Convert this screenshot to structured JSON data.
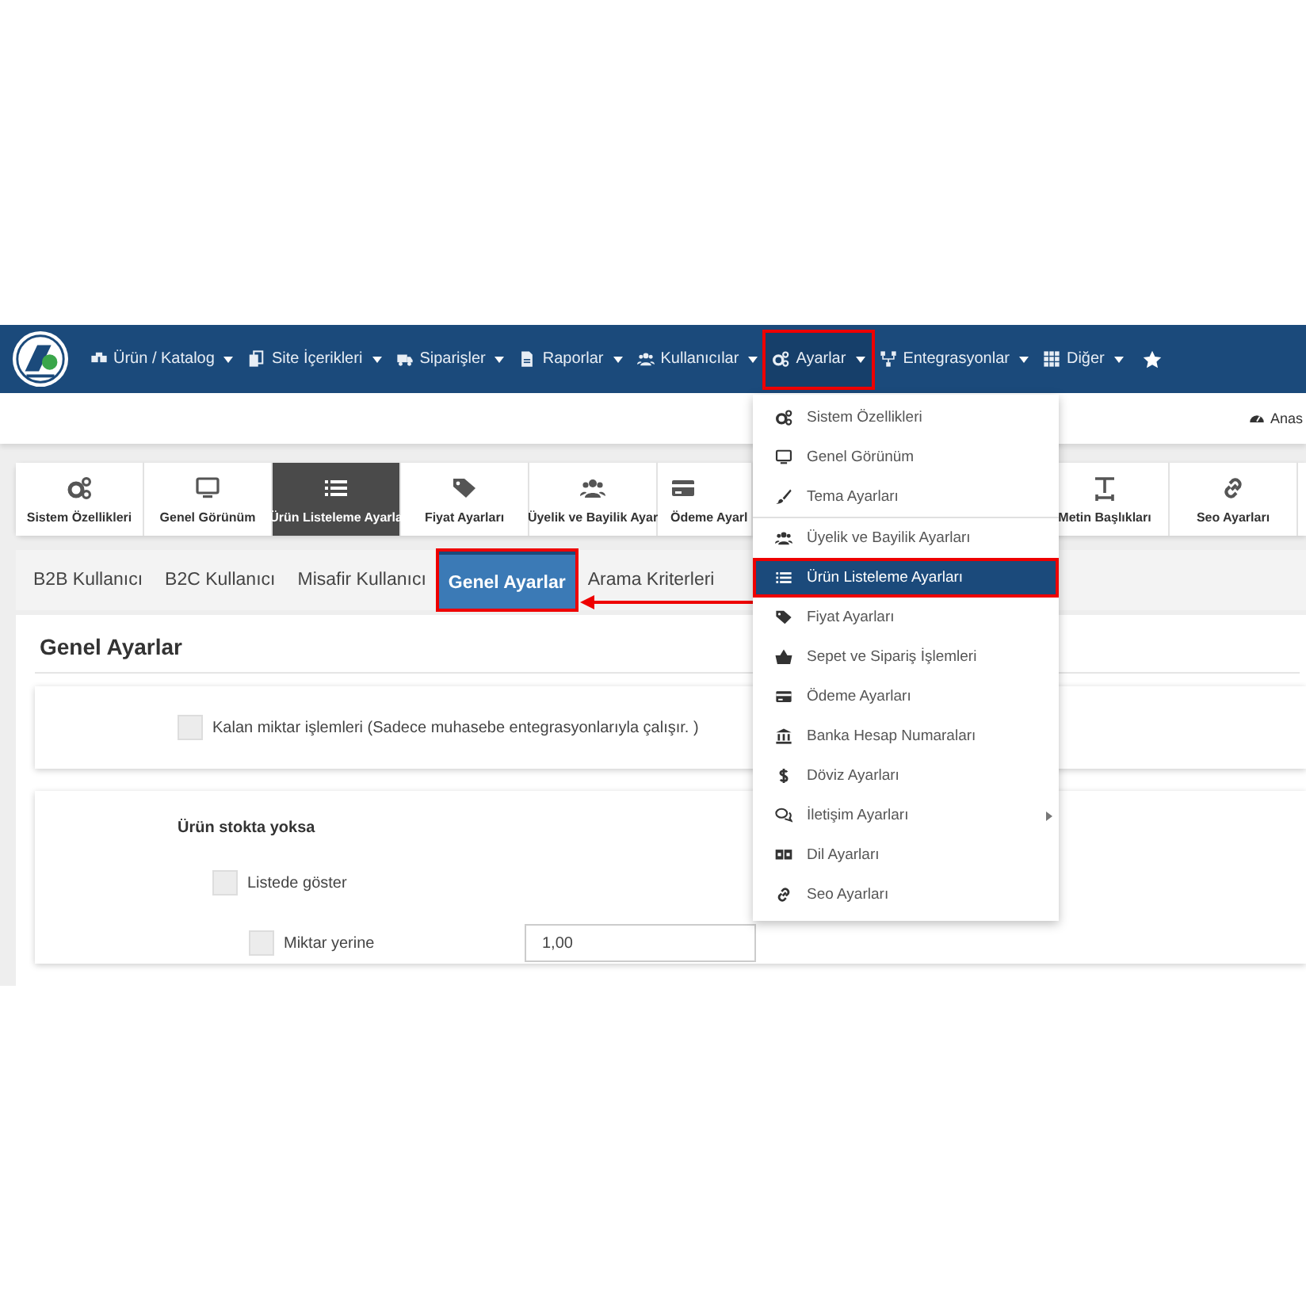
{
  "navbar": {
    "items": [
      {
        "label": "Ürün / Katalog",
        "selected": false,
        "highlighted": false
      },
      {
        "label": "Site İçerikleri",
        "selected": false,
        "highlighted": false
      },
      {
        "label": "Siparişler",
        "selected": false,
        "highlighted": false
      },
      {
        "label": "Raporlar",
        "selected": false,
        "highlighted": false
      },
      {
        "label": "Kullanıcılar",
        "selected": false,
        "highlighted": false
      },
      {
        "label": "Ayarlar",
        "selected": true,
        "highlighted": true
      },
      {
        "label": "Entegrasyonlar",
        "selected": false,
        "highlighted": false
      },
      {
        "label": "Diğer",
        "selected": false,
        "highlighted": false
      }
    ]
  },
  "breadcrumb": {
    "label": "Anas"
  },
  "toolbar": {
    "items": [
      {
        "label": "Sistem Özellikleri",
        "selected": false
      },
      {
        "label": "Genel Görünüm",
        "selected": false
      },
      {
        "label": "Ürün Listeleme Ayarla",
        "selected": true
      },
      {
        "label": "Fiyat Ayarları",
        "selected": false
      },
      {
        "label": "Üyelik ve Bayilik Ayar",
        "selected": false
      },
      {
        "label": "Ödeme Ayarl",
        "selected": false
      },
      {
        "label": "Metin Başlıkları",
        "selected": false
      },
      {
        "label": "Seo Ayarları",
        "selected": false
      }
    ]
  },
  "tabs": [
    {
      "label": "B2B Kullanıcı",
      "selected": false,
      "highlighted": false
    },
    {
      "label": "B2C Kullanıcı",
      "selected": false,
      "highlighted": false
    },
    {
      "label": "Misafir Kullanıcı",
      "selected": false,
      "highlighted": false
    },
    {
      "label": "Genel Ayarlar",
      "selected": true,
      "highlighted": true
    },
    {
      "label": "Arama Kriterleri",
      "selected": false,
      "highlighted": false
    }
  ],
  "panel": {
    "title": "Genel Ayarlar",
    "card_1": {
      "options": [
        {
          "label": "Kalan miktar işlemleri (Sadece muhasebe entegrasyonlarıyla çalışır. )",
          "checked": false
        }
      ]
    },
    "card_2": {
      "heading": "Ürün stokta yoksa",
      "show_in_list": {
        "label": "Listede göster",
        "checked": false
      },
      "rows": [
        {
          "label": "Miktar yerine",
          "checked": false,
          "value": "1,00"
        }
      ]
    }
  },
  "dropdown": {
    "items": [
      {
        "label": "Sistem Özellikleri",
        "selected": false,
        "highlighted": false,
        "submenu": false,
        "divider_after": false
      },
      {
        "label": "Genel Görünüm",
        "selected": false,
        "highlighted": false,
        "submenu": false,
        "divider_after": false
      },
      {
        "label": "Tema Ayarları",
        "selected": false,
        "highlighted": false,
        "submenu": false,
        "divider_after": true
      },
      {
        "label": "Üyelik ve Bayilik Ayarları",
        "selected": false,
        "highlighted": false,
        "submenu": false,
        "divider_after": false
      },
      {
        "label": "Ürün Listeleme Ayarları",
        "selected": true,
        "highlighted": true,
        "submenu": false,
        "divider_after": false
      },
      {
        "label": "Fiyat Ayarları",
        "selected": false,
        "highlighted": false,
        "submenu": false,
        "divider_after": false
      },
      {
        "label": "Sepet ve Sipariş İşlemleri",
        "selected": false,
        "highlighted": false,
        "submenu": false,
        "divider_after": false
      },
      {
        "label": "Ödeme Ayarları",
        "selected": false,
        "highlighted": false,
        "submenu": false,
        "divider_after": false
      },
      {
        "label": "Banka Hesap Numaraları",
        "selected": false,
        "highlighted": false,
        "submenu": false,
        "divider_after": false
      },
      {
        "label": "Döviz Ayarları",
        "selected": false,
        "highlighted": false,
        "submenu": false,
        "divider_after": false
      },
      {
        "label": "İletişim Ayarları",
        "selected": false,
        "highlighted": false,
        "submenu": true,
        "divider_after": false
      },
      {
        "label": "Dil Ayarları",
        "selected": false,
        "highlighted": false,
        "submenu": false,
        "divider_after": false
      },
      {
        "label": "Seo Ayarları",
        "selected": false,
        "highlighted": false,
        "submenu": false,
        "divider_after": false
      }
    ]
  }
}
